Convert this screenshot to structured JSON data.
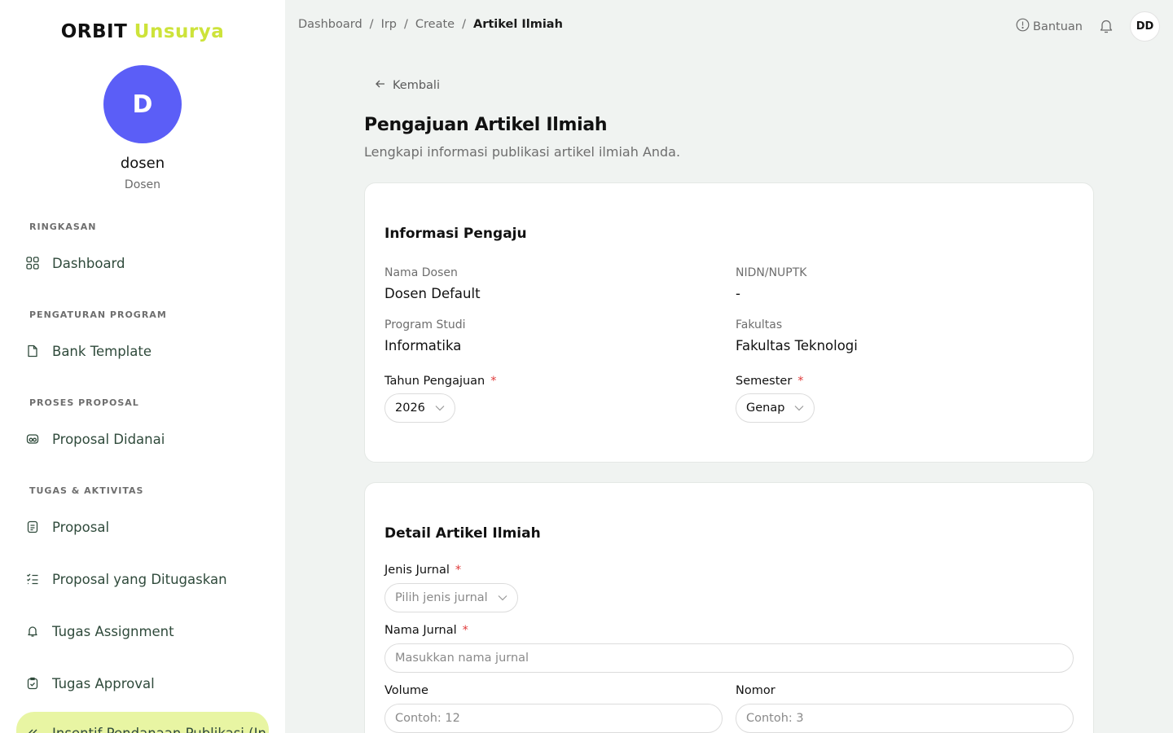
{
  "brand": {
    "part1": "ORBIT",
    "part2": "Unsurya"
  },
  "user": {
    "initial": "D",
    "name": "dosen",
    "role": "Dosen",
    "initials": "DD"
  },
  "sidebar": {
    "sections": [
      {
        "title": "RINGKASAN"
      },
      {
        "title": "PENGATURAN PROGRAM"
      },
      {
        "title": "PROSES PROPOSAL"
      },
      {
        "title": "TUGAS & AKTIVITAS"
      }
    ],
    "items": [
      {
        "label": "Dashboard",
        "icon": "grid-icon"
      },
      {
        "label": "Bank Template",
        "icon": "file-icon"
      },
      {
        "label": "Proposal Didanai",
        "icon": "money-icon"
      },
      {
        "label": "Proposal",
        "icon": "document-icon"
      },
      {
        "label": "Proposal yang Ditugaskan",
        "icon": "checklist-icon"
      },
      {
        "label": "Tugas Assignment",
        "icon": "bell-icon"
      },
      {
        "label": "Tugas Approval",
        "icon": "clipboard-check-icon"
      },
      {
        "label": "Insentif Pendanaan Publikasi (In",
        "icon": "double-chevron-left-icon"
      }
    ]
  },
  "breadcrumb": [
    "Dashboard",
    "Irp",
    "Create",
    "Artikel Ilmiah"
  ],
  "topbar": {
    "help_label": "Bantuan"
  },
  "page": {
    "back_label": "Kembali",
    "title": "Pengajuan Artikel Ilmiah",
    "subtitle": "Lengkapi informasi publikasi artikel ilmiah Anda."
  },
  "card1": {
    "title": "Informasi Pengaju",
    "nama_dosen_label": "Nama Dosen",
    "nama_dosen_value": "Dosen Default",
    "nidn_label": "NIDN/NUPTK",
    "nidn_value": "-",
    "prodi_label": "Program Studi",
    "prodi_value": "Informatika",
    "fakultas_label": "Fakultas",
    "fakultas_value": "Fakultas Teknologi",
    "tahun_label": "Tahun Pengajuan",
    "tahun_value": "2026",
    "semester_label": "Semester",
    "semester_value": "Genap",
    "required_mark": "*"
  },
  "card2": {
    "title": "Detail Artikel Ilmiah",
    "jenis_label": "Jenis Jurnal",
    "jenis_placeholder": "Pilih jenis jurnal",
    "nama_jurnal_label": "Nama Jurnal",
    "nama_jurnal_placeholder": "Masukkan nama jurnal",
    "volume_label": "Volume",
    "volume_placeholder": "Contoh: 12",
    "nomor_label": "Nomor",
    "nomor_placeholder": "Contoh: 3",
    "required_mark": "*"
  },
  "colors": {
    "accent": "#cde33a",
    "avatar": "#5b5ef7",
    "active_nav": "#e8f5a3",
    "required": "#e03a3a"
  }
}
